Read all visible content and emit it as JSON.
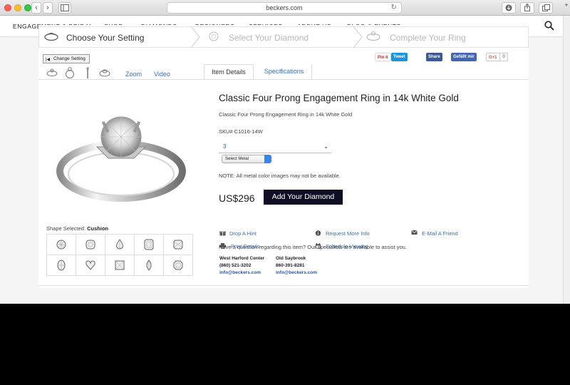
{
  "browser": {
    "url": "beckers.com"
  },
  "nav": {
    "items": [
      "ENGAGEMENT & BRIDAL",
      "SHOP",
      "DIAMONDS",
      "DESIGNERS",
      "SERVICES",
      "ABOUT US",
      "BLOG & EVENTS"
    ]
  },
  "steps": [
    "Choose Your Setting",
    "Select Your Diamond",
    "Complete Your Ring"
  ],
  "change_setting_label": "Change Setting",
  "social": {
    "pin": "Pin it",
    "tweet": "Tweet",
    "share": "Share",
    "like": "Gefällt mir",
    "gplus": "G+1",
    "gplus_count": "0"
  },
  "tabs": {
    "zoom": "Zoom",
    "video": "Video",
    "item_details": "Item Details",
    "specifications": "Specifications"
  },
  "product": {
    "title": "Classic Four Prong Engagement Ring in 14k White Gold",
    "subtitle": "Classic Four Prong Engagement Ring in 14k White Gold",
    "sku": "SKU# C1016-14W",
    "size_value": "3",
    "metal_placeholder": "Select Metal",
    "note": "NOTE: All metal color images may not be available.",
    "price": "US$296",
    "add_button": "Add Your Diamond"
  },
  "actions": {
    "drop_hint": "Drop A Hint",
    "request_info": "Request More Info",
    "email_friend": "E-Mail A Friend",
    "print_details": "Print Details",
    "schedule_viewing": "Schedule Viewing"
  },
  "contact": {
    "question": "Have a question regarding this item? Our specialists are available to assist you.",
    "stores": [
      {
        "name": "West Harford Center",
        "phone": "(860) 521-3202",
        "email": "info@beckers.com"
      },
      {
        "name": "Old Saybrook",
        "phone": "860-391-8281",
        "email": "info@beckers.com"
      }
    ]
  },
  "shape": {
    "label": "Shape Selected:",
    "selected": "Cushion"
  },
  "colors": {
    "link_blue": "#3b6fb6",
    "button_navy": "#0e0e24",
    "step_inactive": "#b8b8b8"
  }
}
